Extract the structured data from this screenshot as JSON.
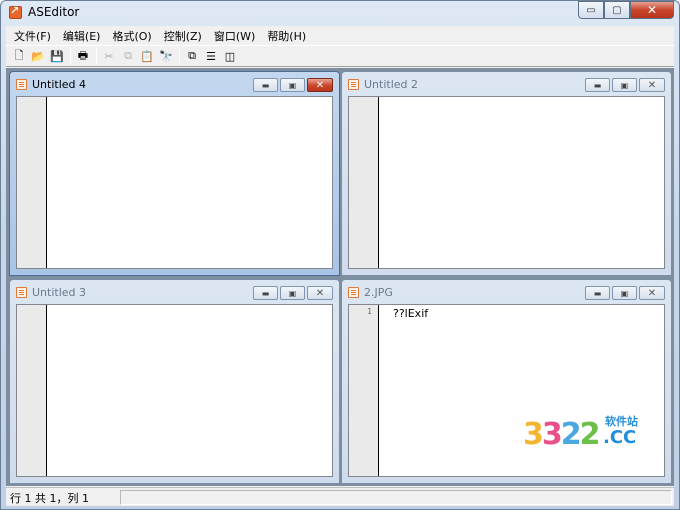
{
  "window": {
    "title": "ASEditor",
    "caption": {
      "minimize": "▭",
      "maximize": "▢",
      "close": "✕"
    }
  },
  "menubar": {
    "items": [
      {
        "label": "文件(F)"
      },
      {
        "label": "编辑(E)"
      },
      {
        "label": "格式(O)"
      },
      {
        "label": "控制(Z)"
      },
      {
        "label": "窗口(W)"
      },
      {
        "label": "帮助(H)"
      }
    ]
  },
  "toolbar": {
    "buttons": [
      {
        "icon": "new-file-icon",
        "glyph": "🗋"
      },
      {
        "icon": "open-folder-icon",
        "glyph": "📂"
      },
      {
        "icon": "save-icon",
        "glyph": "💾"
      },
      {
        "icon": "print-icon",
        "glyph": "🖶"
      },
      {
        "icon": "cut-icon",
        "glyph": "✂"
      },
      {
        "icon": "copy-icon",
        "glyph": "⧉"
      },
      {
        "icon": "paste-icon",
        "glyph": "📋"
      },
      {
        "icon": "find-icon",
        "glyph": "🔭"
      },
      {
        "icon": "cascade-windows-icon",
        "glyph": "⧉"
      },
      {
        "icon": "tile-horizontal-icon",
        "glyph": "☰"
      },
      {
        "icon": "tile-vertical-icon",
        "glyph": "◫"
      }
    ]
  },
  "children": [
    {
      "title": "Untitled 4",
      "active": true,
      "lines": []
    },
    {
      "title": "Untitled 2",
      "active": false,
      "lines": []
    },
    {
      "title": "Untitled 3",
      "active": false,
      "lines": []
    },
    {
      "title": "2.JPG",
      "active": false,
      "line_number": "1",
      "lines": [
        "??lExif"
      ]
    }
  ],
  "child_caption": {
    "minimize": "▬",
    "maximize": "▣",
    "close": "✕"
  },
  "statusbar": {
    "position": "行 1 共 1，列 1"
  },
  "watermark": {
    "digits": [
      "3",
      "3",
      "2",
      "2"
    ],
    "cn": "软件站",
    "domain": ".CC"
  }
}
